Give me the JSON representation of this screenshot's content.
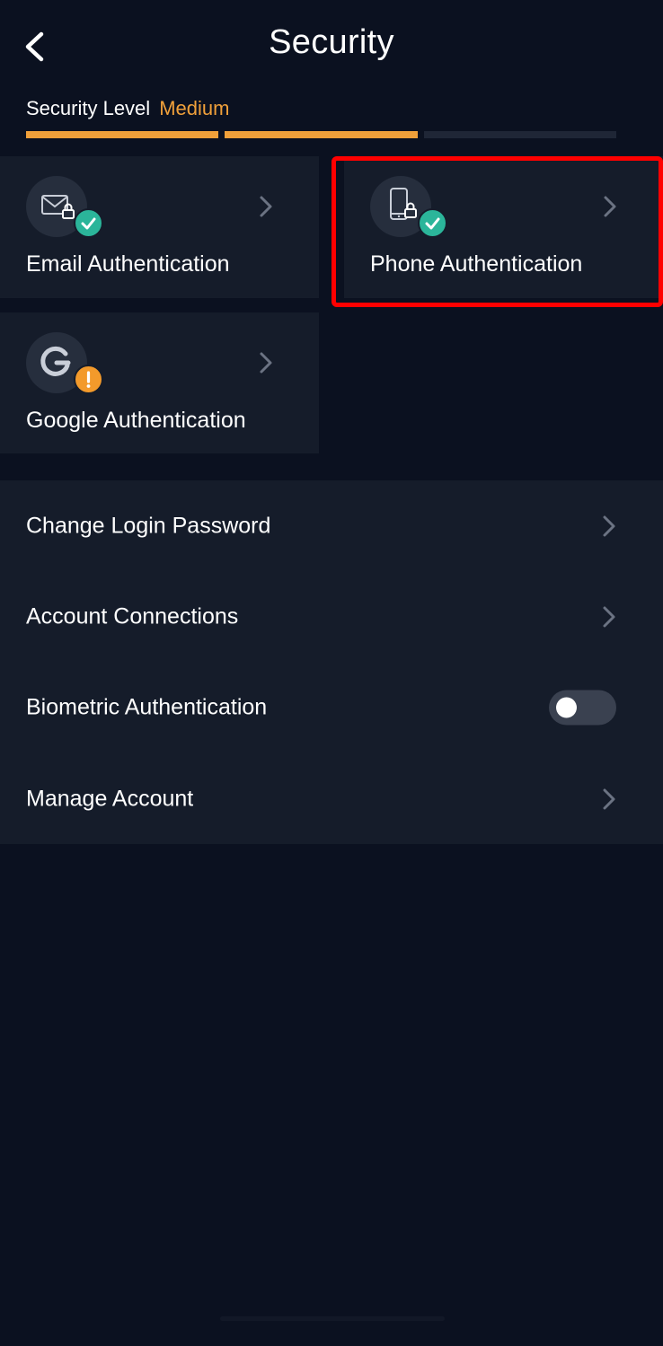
{
  "header": {
    "title": "Security"
  },
  "security_level": {
    "label": "Security Level",
    "value": "Medium",
    "filled_segments": 2,
    "total_segments": 3
  },
  "auth_cards": [
    {
      "label": "Email Authentication",
      "icon": "email-lock-icon",
      "status": "verified"
    },
    {
      "label": "Phone Authentication",
      "icon": "phone-lock-icon",
      "status": "verified"
    },
    {
      "label": "Google Authentication",
      "icon": "google-authenticator-icon",
      "status": "warning"
    }
  ],
  "menu": {
    "change_password": "Change Login Password",
    "account_connections": "Account Connections",
    "biometric": {
      "label": "Biometric Authentication",
      "enabled": false
    },
    "manage_account": "Manage Account"
  },
  "colors": {
    "background": "#0b1120",
    "card": "#151c2a",
    "accent": "#f0a03a",
    "success": "#2bb59a",
    "warning": "#f39a2b",
    "highlight": "#ff0000"
  }
}
